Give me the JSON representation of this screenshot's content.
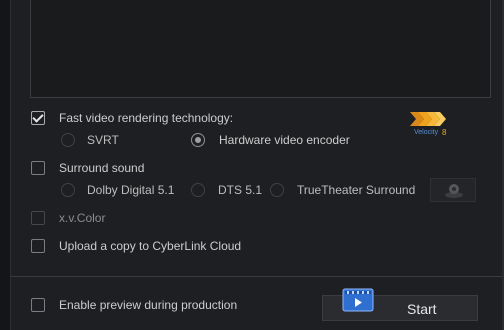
{
  "options": {
    "fast_video_rendering": {
      "label": "Fast video rendering technology:",
      "checked": true
    },
    "svrt": {
      "label": "SVRT",
      "selected": false
    },
    "hardware_encoder": {
      "label": "Hardware video encoder",
      "selected": true
    },
    "velocity_logo": {
      "text": "Velocity 8",
      "icon": "velocity-8-logo"
    },
    "surround_sound": {
      "label": "Surround sound",
      "checked": false
    },
    "dolby": {
      "label": "Dolby Digital 5.1",
      "selected": false
    },
    "dts": {
      "label": "DTS 5.1",
      "selected": false
    },
    "truetheater": {
      "label": "TrueTheater Surround",
      "selected": false
    },
    "surround_settings_icon": "speaker-settings-icon",
    "xvcolor": {
      "label": "x.v.Color",
      "checked": false,
      "enabled": false
    },
    "upload_cloud": {
      "label": "Upload a copy to CyberLink Cloud",
      "checked": false
    }
  },
  "footer": {
    "enable_preview": {
      "label": "Enable preview during production",
      "checked": false
    },
    "start_button": {
      "label": "Start",
      "icon": "play-film-icon"
    }
  },
  "colors": {
    "accent_orange": "#f0a21c",
    "velocity_blue": "#5a8fd8"
  }
}
